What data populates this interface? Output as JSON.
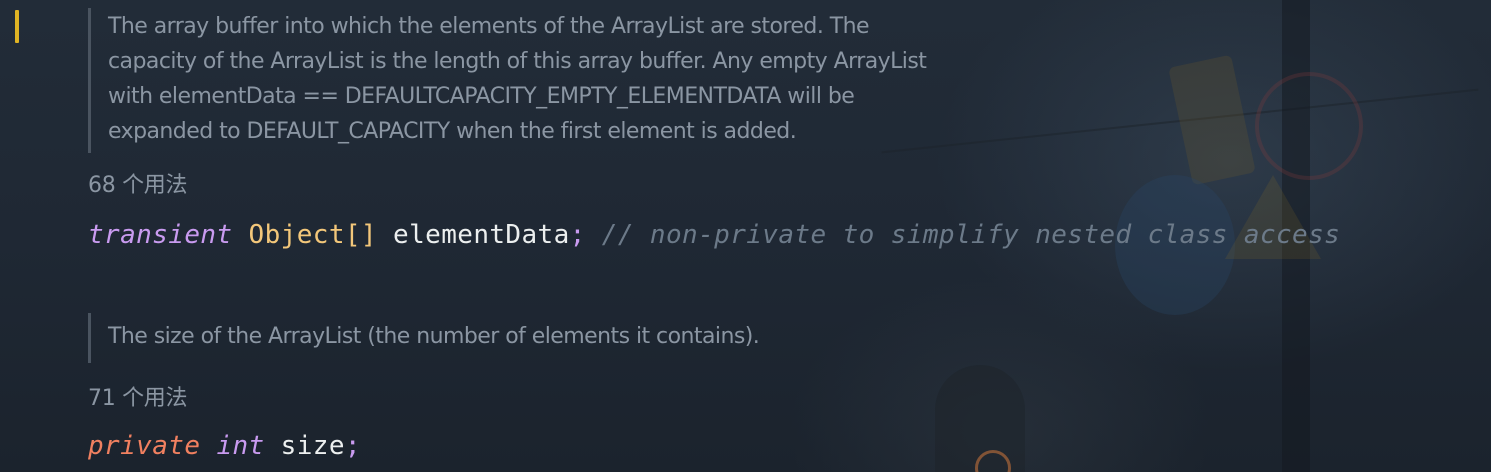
{
  "editor": {
    "doc_comments": [
      {
        "lines": [
          "The array buffer into which the elements of the ArrayList are stored. The",
          "capacity of the ArrayList is the length of this array buffer. Any empty ArrayList",
          "with elementData == DEFAULTCAPACITY_EMPTY_ELEMENTDATA will be",
          "expanded to DEFAULT_CAPACITY when the first element is added."
        ]
      },
      {
        "lines": [
          "The size of the ArrayList (the number of elements it contains)."
        ]
      }
    ],
    "usage_hints": [
      "68 个用法",
      "71 个用法"
    ],
    "code_lines": [
      {
        "modifier": "transient",
        "type": "Object[]",
        "name": "elementData",
        "semicolon": ";",
        "comment": "// non-private to simplify nested class access"
      },
      {
        "modifier": "private",
        "type": "int",
        "name": "size",
        "semicolon": ";"
      }
    ]
  },
  "colors": {
    "background": "#1e2733",
    "doc_text": "#8b96a3",
    "keyword": "#c99bf0",
    "private_keyword": "#f08060",
    "class_type": "#f3c77a",
    "comment": "#6c7a89",
    "change_marker": "#e0b424"
  }
}
